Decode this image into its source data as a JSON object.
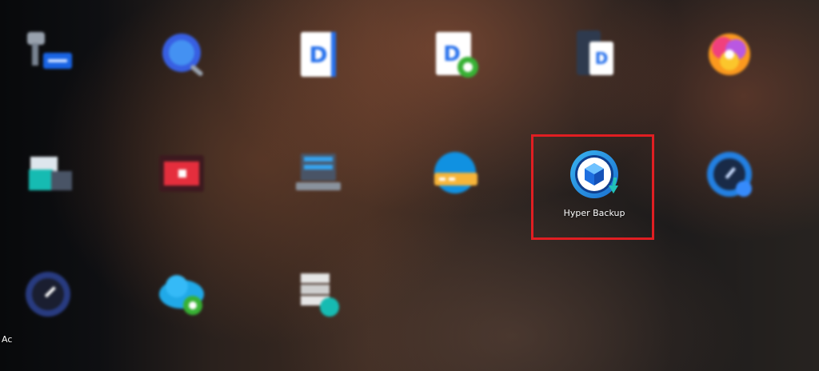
{
  "desktop": {
    "highlighted_app": {
      "label": "Hyper Backup",
      "icon": "hyper-backup-icon"
    },
    "partial_label": "Ac",
    "blurred_apps": [
      {
        "icon": "key-access-icon"
      },
      {
        "icon": "search-globe-icon"
      },
      {
        "icon": "document-d-icon"
      },
      {
        "icon": "document-d-sync-icon"
      },
      {
        "icon": "document-d-phone-icon"
      },
      {
        "icon": "colorful-photos-icon"
      },
      {
        "icon": "storage-box-icon"
      },
      {
        "icon": "video-player-icon"
      },
      {
        "icon": "laptop-manager-icon"
      },
      {
        "icon": "disk-globe-icon"
      },
      {
        "icon": "backup-gauge-icon"
      },
      {
        "icon": "speedometer-icon"
      },
      {
        "icon": "cloud-sync-icon"
      },
      {
        "icon": "server-stack-icon"
      }
    ]
  },
  "colors": {
    "highlight": "#e01e22",
    "hyper_backup_blue": "#1a8fd8",
    "hyper_backup_teal": "#22c3b8"
  }
}
